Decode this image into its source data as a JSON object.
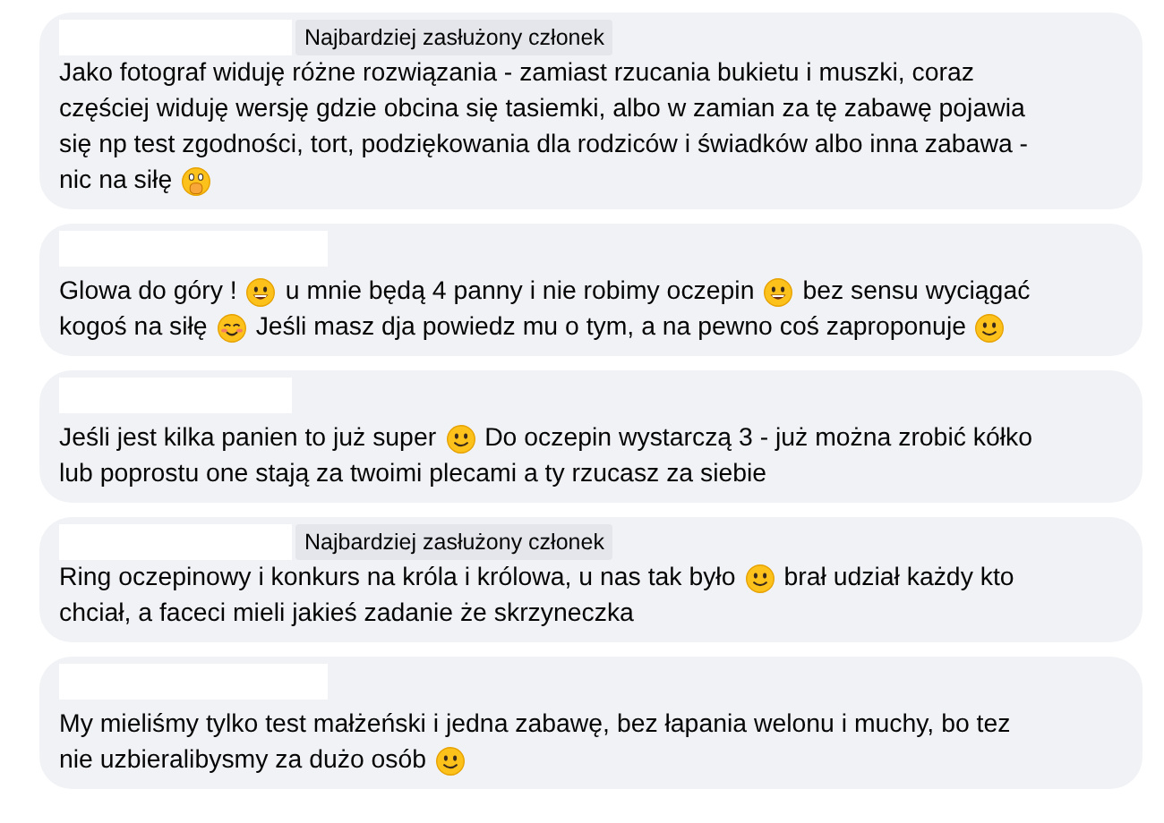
{
  "comments": [
    {
      "badge": "Najbardziej zasłużony członek",
      "lines": [
        [
          {
            "kind": "text",
            "text": "Jako fotograf widuję różne rozwiązania - zamiast rzucania bukietu i muszki, coraz"
          }
        ],
        [
          {
            "kind": "text",
            "text": "częściej widuję wersję gdzie obcina się tasiemki, albo w zamian za tę zabawę pojawia"
          }
        ],
        [
          {
            "kind": "text",
            "text": "się np test zgodności, tort, podziękowania dla rodziców i świadków albo inna zabawa -"
          }
        ],
        [
          {
            "kind": "text",
            "text": "nic na siłę"
          },
          {
            "kind": "covered-mouth"
          }
        ]
      ]
    },
    {
      "lines": [
        [
          {
            "kind": "text",
            "text": "Glowa do góry !"
          },
          {
            "kind": "grin"
          },
          {
            "kind": "text",
            "text": "u mnie będą 4 panny i nie robimy oczepin"
          },
          {
            "kind": "grin"
          },
          {
            "kind": "text",
            "text": "bez sensu wyciągać"
          }
        ],
        [
          {
            "kind": "text",
            "text": "kogoś na siłę"
          },
          {
            "kind": "blush"
          },
          {
            "kind": "text",
            "text": "Jeśli masz dja powiedz mu o tym, a na pewno coś zaproponuje"
          },
          {
            "kind": "smile"
          }
        ]
      ]
    },
    {
      "lines": [
        [
          {
            "kind": "text",
            "text": "Jeśli jest kilka panien to już super"
          },
          {
            "kind": "smile"
          },
          {
            "kind": "text",
            "text": "Do oczepin wystarczą 3 - już można zrobić kółko"
          }
        ],
        [
          {
            "kind": "text",
            "text": "lub poprostu one stają za twoimi plecami a ty rzucasz za siebie"
          }
        ]
      ]
    },
    {
      "badge": "Najbardziej zasłużony członek",
      "lines": [
        [
          {
            "kind": "text",
            "text": "Ring oczepinowy i konkurs na króla i królowa, u nas tak było"
          },
          {
            "kind": "smile"
          },
          {
            "kind": "text",
            "text": "brał udział każdy kto"
          }
        ],
        [
          {
            "kind": "text",
            "text": "chciał, a faceci mieli jakieś zadanie że skrzyneczka"
          }
        ]
      ]
    },
    {
      "lines": [
        [
          {
            "kind": "text",
            "text": "My mieliśmy tylko test małżeński i jedna zabawę, bez łapania welonu i muchy, bo tez"
          }
        ],
        [
          {
            "kind": "text",
            "text": "nie uzbieralibysmy za dużo osób"
          },
          {
            "kind": "smile"
          }
        ]
      ]
    }
  ]
}
